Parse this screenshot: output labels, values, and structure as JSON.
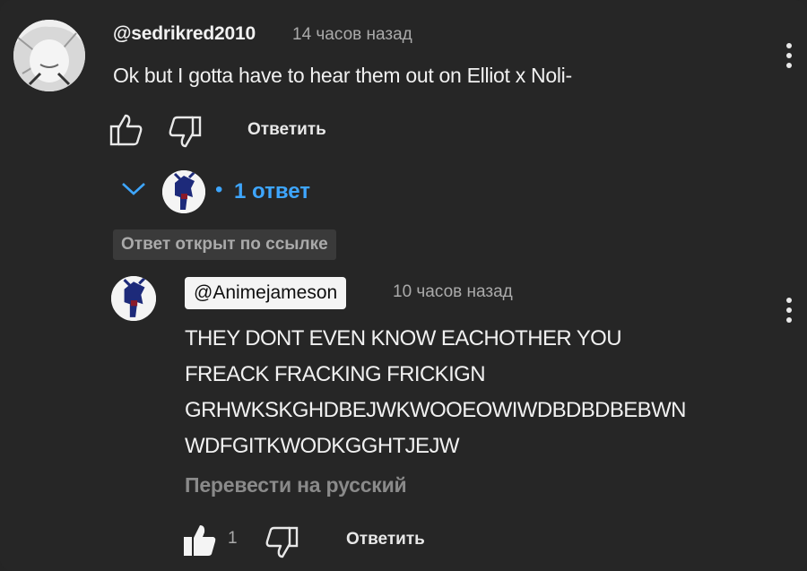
{
  "comment": {
    "author": "@sedrikred2010",
    "time": "14 часов назад",
    "text": "Ok but I gotta have to hear them out on Elliot x Noli-",
    "reply_label": "Ответить"
  },
  "replies_toggle": {
    "dot": "•",
    "label": "1 ответ"
  },
  "link_badge": "Ответ открыт по ссылке",
  "reply": {
    "author": "@Animejameson",
    "time": "10 часов назад",
    "text_lines": [
      "THEY DONT EVEN KNOW EACHOTHER YOU",
      "FREACK FRACKING FRICKIGN",
      "GRHWKSKGHDBEJWKWOOEOWIWDBDBDBEBWN",
      "WDFGITKWODKGGHTJEJW"
    ],
    "translate_label": "Перевести на русский",
    "like_count": "1",
    "reply_label": "Ответить"
  },
  "colors": {
    "background": "#262626",
    "link_blue": "#3ea6ff",
    "secondary_text": "#aaaaaa"
  },
  "icons": {
    "like": "thumbs-up-outline",
    "dislike": "thumbs-down-outline",
    "liked": "thumbs-up-filled",
    "more": "vertical-ellipsis",
    "expand": "chevron-down"
  }
}
